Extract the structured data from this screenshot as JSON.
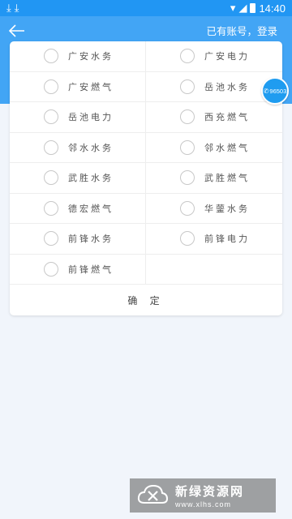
{
  "status_bar": {
    "left_icons": "download-icons",
    "time": "14:40"
  },
  "header": {
    "back_icon": "arrow-left-icon",
    "login_link": "已有账号，登录"
  },
  "services": [
    {
      "label": "广安水务"
    },
    {
      "label": "广安电力"
    },
    {
      "label": "广安燃气"
    },
    {
      "label": "岳池水务"
    },
    {
      "label": "岳池电力"
    },
    {
      "label": "西充燃气"
    },
    {
      "label": "邻水水务"
    },
    {
      "label": "邻水燃气"
    },
    {
      "label": "武胜水务"
    },
    {
      "label": "武胜燃气"
    },
    {
      "label": "德宏燃气"
    },
    {
      "label": "华蓥水务"
    },
    {
      "label": "前锋水务"
    },
    {
      "label": "前锋电力"
    },
    {
      "label": "前锋燃气"
    }
  ],
  "confirm_label": "确 定",
  "fab": {
    "icon": "phone-icon",
    "number": "96503"
  },
  "watermark": {
    "title": "新绿资源网",
    "url": "www.xlhs.com"
  }
}
